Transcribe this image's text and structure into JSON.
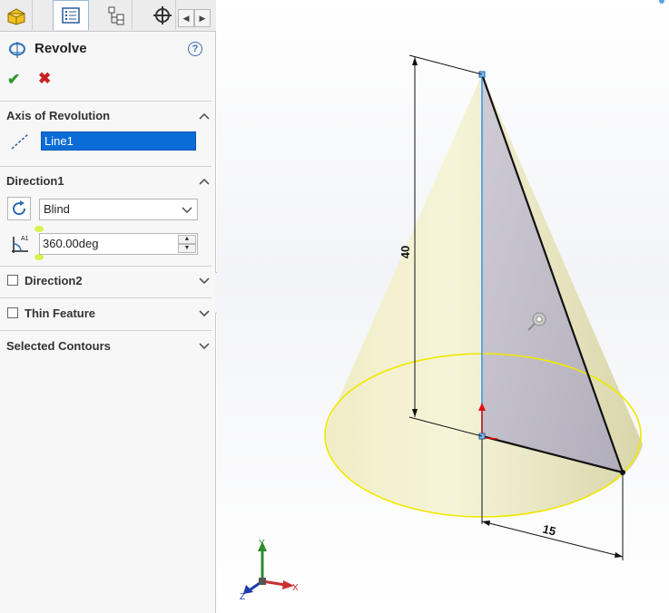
{
  "property_manager": {
    "tabs": [
      {
        "icon": "feature-manager-icon"
      },
      {
        "icon": "property-manager-icon",
        "active": true
      },
      {
        "icon": "configuration-manager-icon"
      },
      {
        "icon": "dimxpert-icon"
      }
    ],
    "title": "Revolve",
    "axis_of_revolution": {
      "label": "Axis of Revolution",
      "value": "Line1"
    },
    "direction1": {
      "label": "Direction1",
      "end_condition": "Blind",
      "angle": "360.00deg"
    },
    "direction2": {
      "label": "Direction2",
      "checked": false
    },
    "thin_feature": {
      "label": "Thin Feature",
      "checked": false
    },
    "selected_contours": {
      "label": "Selected Contours"
    }
  },
  "graphics": {
    "dim_height": "40",
    "dim_radius": "15",
    "triad": {
      "x": "X",
      "y": "Y",
      "z": "Z"
    },
    "colors": {
      "cone": "#ece9bf",
      "section": "#bcb9cf",
      "axis": "#5aa5e6",
      "edge": "#f0e800"
    }
  }
}
